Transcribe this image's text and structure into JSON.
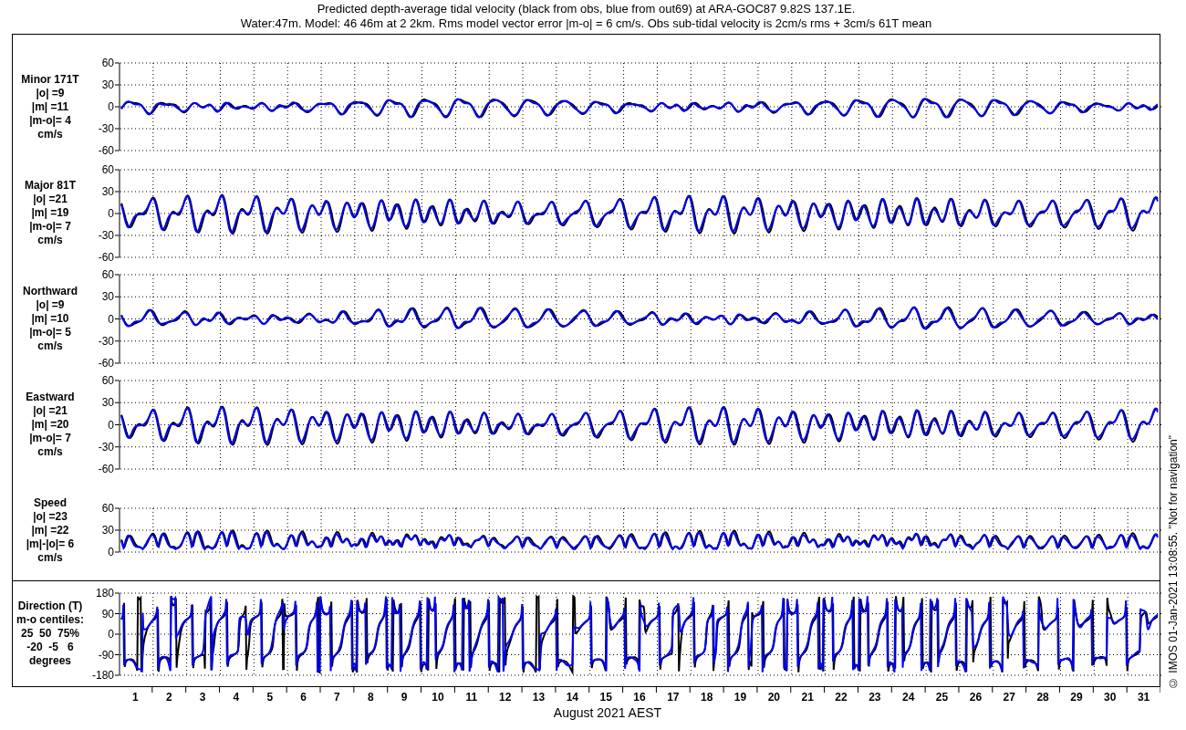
{
  "title": [
    "Predicted depth-average tidal velocity (black from obs, blue from out69) at ARA-GOC87 9.82S 137.1E.",
    "Water:47m. Model: 46 46m at 2 2km. Rms model vector error |m-o| = 6 cm/s. Obs sub-tidal velocity is 2cm/s rms + 3cm/s 61T mean"
  ],
  "panels": [
    {
      "kind": "minor",
      "label": [
        "Minor 171T",
        "|o| =9",
        "|m| =11",
        "|m-o|= 4",
        "cm/s"
      ],
      "yticks": [
        "60",
        "30",
        "0",
        "-30",
        "-60"
      ]
    },
    {
      "kind": "major",
      "label": [
        "Major 81T",
        "|o| =21",
        "|m| =19",
        "|m-o|= 7",
        "cm/s"
      ],
      "yticks": [
        "60",
        "30",
        "0",
        "-30",
        "-60"
      ]
    },
    {
      "kind": "northward",
      "label": [
        "Northward",
        "|o| =9",
        "|m| =10",
        "|m-o|= 5",
        "cm/s"
      ],
      "yticks": [
        "60",
        "30",
        "0",
        "-30",
        "-60"
      ]
    },
    {
      "kind": "eastward",
      "label": [
        "Eastward",
        "|o| =21",
        "|m| =20",
        "|m-o|= 7",
        "cm/s"
      ],
      "yticks": [
        "60",
        "30",
        "0",
        "-30",
        "-60"
      ]
    },
    {
      "kind": "speed",
      "label": [
        "Speed",
        "|o| =23",
        "|m| =22",
        "|m|-|o|= 6",
        "cm/s"
      ],
      "yticks": [
        "60",
        "30",
        "0"
      ]
    },
    {
      "kind": "direction",
      "label": [
        "Direction (T)",
        "m-o centiles:",
        "25  50  75%",
        "-20  -5   6",
        "degrees"
      ],
      "yticks": [
        "180",
        "90",
        "0",
        "-90",
        "-180"
      ]
    }
  ],
  "xticks": [
    "1",
    "2",
    "3",
    "4",
    "5",
    "6",
    "7",
    "8",
    "9",
    "10",
    "11",
    "12",
    "13",
    "14",
    "15",
    "16",
    "17",
    "18",
    "19",
    "20",
    "21",
    "22",
    "23",
    "24",
    "25",
    "26",
    "27",
    "28",
    "29",
    "30",
    "31"
  ],
  "xlabel": "August 2021 AEST",
  "credit": "© IMOS 01-Jan-2021 13:08:55. \"Not for navigation\""
}
